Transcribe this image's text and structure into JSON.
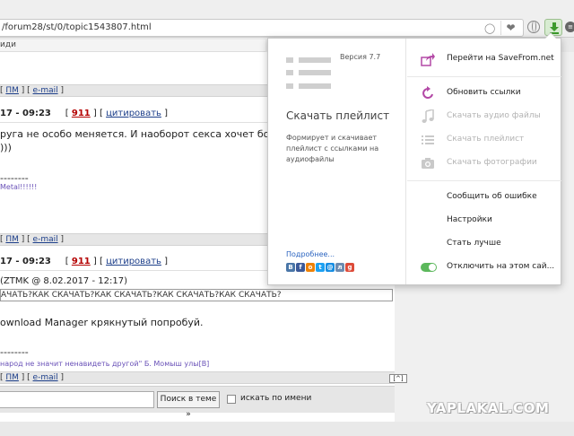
{
  "browser": {
    "url": "/forum28/st/0/topic1543807.html",
    "toprow_text": "иди"
  },
  "forum": {
    "post1": {
      "links": [
        "ПМ",
        "e-mail"
      ],
      "meta_time": "17 - 09:23",
      "post_num": "911",
      "quote_label": "цитировать",
      "text_line1": "руга не особо меняется. И наоборот секса хочет больше)",
      "text_line2": ")))",
      "sig_dash": "--------",
      "signature": "Metal!!!!!!"
    },
    "post2": {
      "links": [
        "ПМ",
        "e-mail"
      ],
      "meta_time": "17 - 09:23",
      "post_num": "911",
      "quote_label": "цитировать",
      "quote_header": "(ZTMK @ 8.02.2017 - 12:17)",
      "quote_text": "АЧАТЬ?КАК СКАЧАТЬ?КАК СКАЧАТЬ?КАК СКАЧАТЬ?КАК СКАЧАТЬ?",
      "text": "ownload Manager крякнутый попробуй.",
      "sig_dash": "--------",
      "signature": "народ не значит ненавидеть другой\" Б. Момыш улы[B]"
    },
    "post3": {
      "links": [
        "ПМ",
        "e-mail"
      ]
    },
    "up_button": "[^]",
    "search_button": "Поиск в теме »",
    "search_by_name": "искать по имени"
  },
  "popup": {
    "version": "Версия 7.7",
    "title": "Скачать плейлист",
    "description": "Формирует и скачивает плейлист с ссылками на аудиофайлы",
    "more_link": "Подробнее...",
    "menu": {
      "go_to_site": "Перейти на SaveFrom.net",
      "refresh_links": "Обновить ссылки",
      "download_audio": "Скачать аудио файлы",
      "download_playlist": "Скачать плейлист",
      "download_photos": "Скачать фотографии",
      "report_error": "Сообщить об ошибке",
      "settings": "Настройки",
      "become_better": "Стать лучше",
      "disable_site": "Отключить на этом сай..."
    },
    "colors": {
      "accent": "#b348a6",
      "disabled": "#c9c9c9",
      "toggle": "#5cb85c"
    }
  },
  "watermark": "YAPLAKAL.COM"
}
